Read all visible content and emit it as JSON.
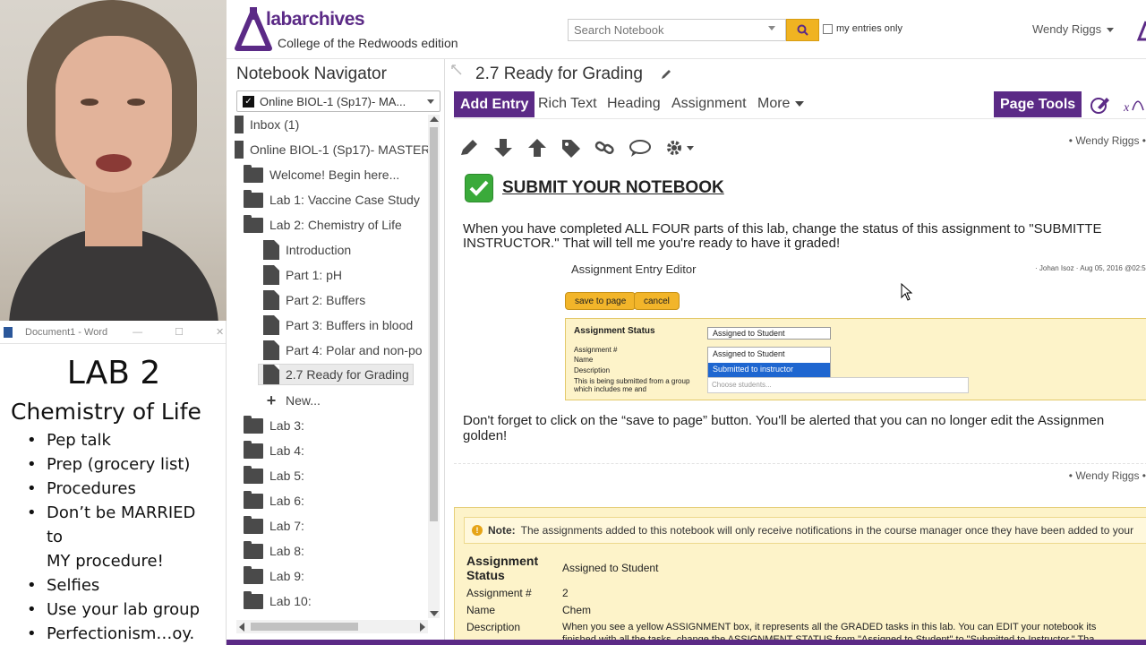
{
  "word_doc": {
    "window_title": "Document1 - Word",
    "controls": [
      "—",
      "☐",
      "✕"
    ],
    "heading": "LAB 2",
    "subheading": "Chemistry of Life",
    "bullets": [
      "Pep talk",
      "Prep (grocery list)",
      "Procedures",
      "Don’t be MARRIED to",
      "MY procedure!",
      "Selfies",
      "Use your lab group",
      "Perfectionism…oy."
    ]
  },
  "header": {
    "brand": "labarchives",
    "edition": "College of the Redwoods edition",
    "search_placeholder": "Search Notebook",
    "my_entries_label": "my entries only",
    "user_name": "Wendy Riggs",
    "brand_color": "#5b2a86",
    "search_button_color": "#f0b322"
  },
  "navigator": {
    "title": "Notebook Navigator",
    "notebook_select": "Online BIOL-1 (Sp17)- MA...",
    "items": [
      {
        "label": "Inbox (1)",
        "icon": "inbox-icon"
      },
      {
        "label": "Online BIOL-1 (Sp17)- MASTER",
        "icon": "notebook-icon"
      },
      {
        "label": "Welcome! Begin here...",
        "icon": "folder-icon"
      },
      {
        "label": "Lab 1: Vaccine Case Study",
        "icon": "folder-icon"
      },
      {
        "label": "Lab 2: Chemistry of Life",
        "icon": "folder-icon"
      },
      {
        "label": "Introduction",
        "icon": "page-icon"
      },
      {
        "label": "Part 1: pH",
        "icon": "page-icon"
      },
      {
        "label": "Part 2: Buffers",
        "icon": "page-icon"
      },
      {
        "label": "Part 3: Buffers in blood",
        "icon": "page-icon"
      },
      {
        "label": "Part 4: Polar and non-po",
        "icon": "page-icon"
      },
      {
        "label": "2.7 Ready for Grading",
        "icon": "page-icon",
        "selected": true
      },
      {
        "label": "New...",
        "icon": "plus-icon"
      },
      {
        "label": "Lab 3:",
        "icon": "folder-icon"
      },
      {
        "label": "Lab 4:",
        "icon": "folder-icon"
      },
      {
        "label": "Lab 5:",
        "icon": "folder-icon"
      },
      {
        "label": "Lab 6:",
        "icon": "folder-icon"
      },
      {
        "label": "Lab 7:",
        "icon": "folder-icon"
      },
      {
        "label": "Lab 8:",
        "icon": "folder-icon"
      },
      {
        "label": "Lab 9:",
        "icon": "folder-icon"
      },
      {
        "label": "Lab 10:",
        "icon": "folder-icon"
      }
    ]
  },
  "page": {
    "title": "2.7 Ready for Grading",
    "toolbar": {
      "add_entry": "Add Entry",
      "rich_text": "Rich Text",
      "heading": "Heading",
      "assignment": "Assignment",
      "more": "More",
      "page_tools": "Page Tools"
    },
    "entry1": {
      "author": "• Wendy Riggs •",
      "heading": "SUBMIT YOUR NOTEBOOK",
      "para1_line1": "When you have completed ALL FOUR parts of this lab, change the status of this assignment to \"SUBMITTE",
      "para1_line2": "INSTRUCTOR.\"  That will tell me you're ready to have it graded!",
      "para2_line1": "Don't forget to click on the “save to page” button. You'll be alerted that you can no longer edit the Assignmen",
      "para2_line2": "golden!"
    },
    "screenshot": {
      "title": "Assignment Entry Editor",
      "meta": "· Johan Isoz · Aug 05, 2016 @02:5",
      "save_btn": "save to page",
      "cancel_btn": "cancel",
      "status_label": "Assignment Status",
      "rows": [
        "Assignment #",
        "Name",
        "Description",
        "This is being submitted from a group",
        "which includes me and"
      ],
      "dropdown_value": "Assigned to Student",
      "options": [
        "Assigned to Student",
        "Submitted to instructor"
      ],
      "choose_placeholder": "Choose students..."
    },
    "entry2": {
      "author": "• Wendy Riggs •",
      "note_label": "Note:",
      "note_text": "The assignments added to this notebook will only receive notifications in the course manager once they have been added to your",
      "status_key": "Assignment Status",
      "status_value": "Assigned to Student",
      "number_key": "Assignment #",
      "number_value": "2",
      "name_key": "Name",
      "name_value": "Chem",
      "desc_key": "Description",
      "desc_line1": "When you see a yellow ASSIGNMENT box, it represents all the GRADED tasks in this lab. You can EDIT your notebook its",
      "desc_line2": "finished with all the tasks, change the ASSIGNMENT STATUS from \"Assigned to Student\" to \"Submitted to Instructor.\" Tha"
    }
  }
}
